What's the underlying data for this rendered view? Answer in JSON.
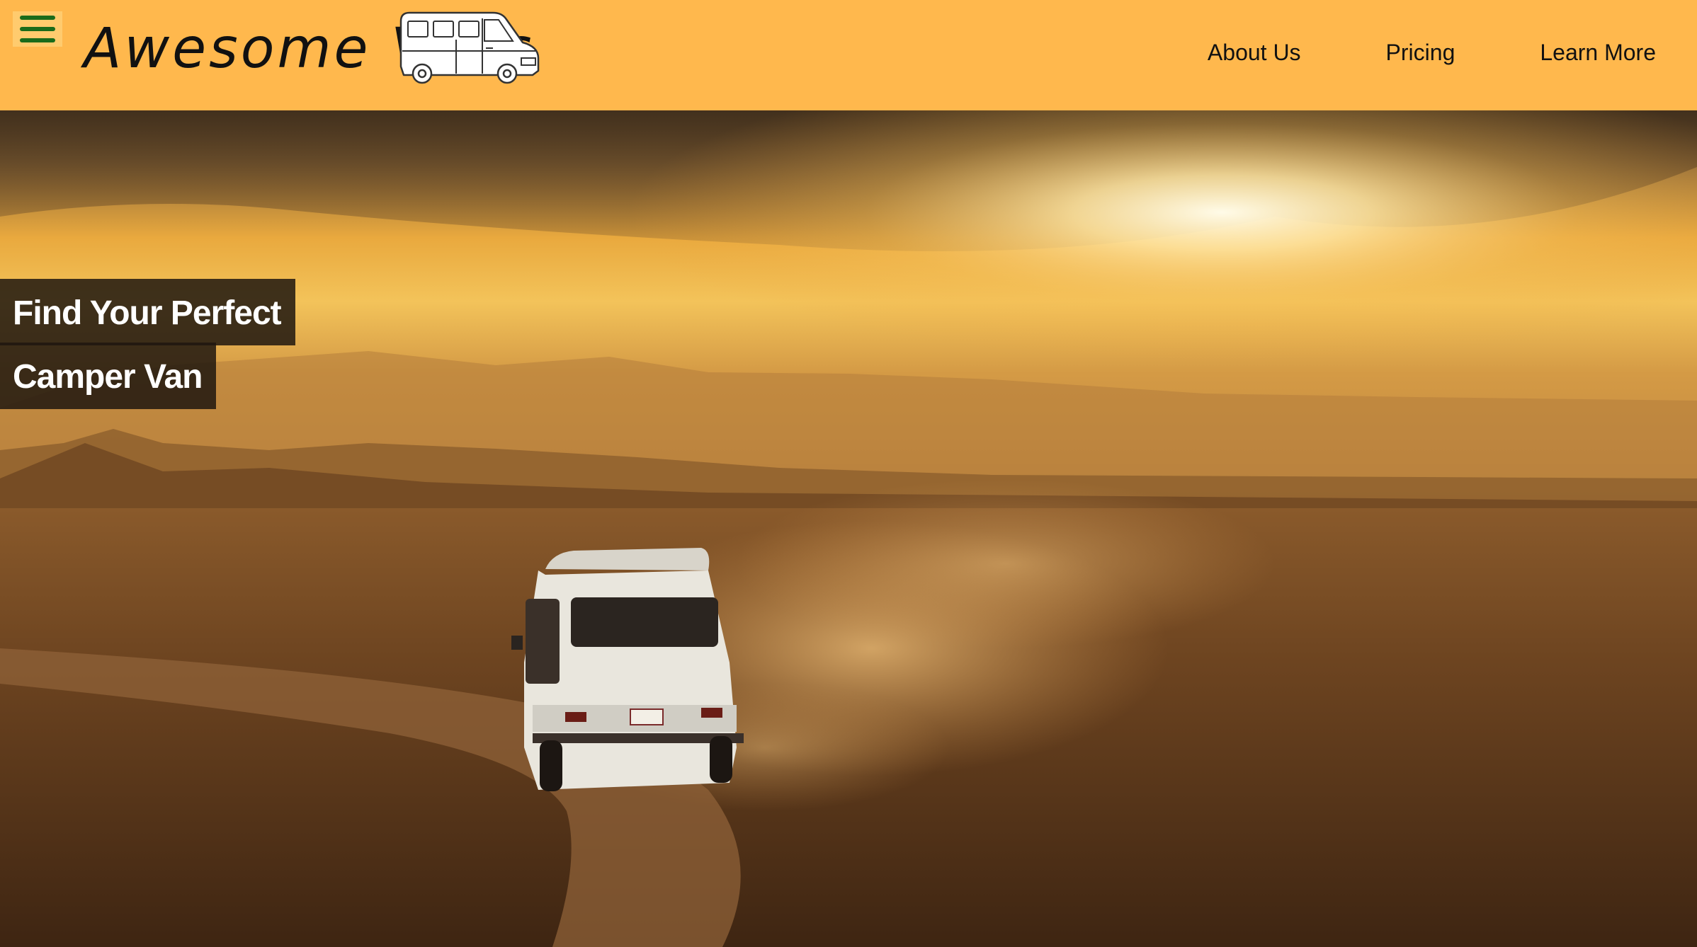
{
  "header": {
    "menu_icon": "hamburger-menu-icon",
    "brand_name": "Awesome Vans",
    "logo_icon": "camper-van-icon",
    "nav": [
      {
        "label": "About Us"
      },
      {
        "label": "Pricing"
      },
      {
        "label": "Learn More"
      }
    ]
  },
  "hero": {
    "background": "desert-sunset-with-camper-van",
    "headline_line1": "Find Your Perfect",
    "headline_line2": "Camper Van"
  },
  "colors": {
    "header_bg": "#ffb84d",
    "menu_icon": "#1a6b1a",
    "text": "#111111",
    "headline_bg": "#1e160f",
    "headline_text": "#ffffff"
  }
}
